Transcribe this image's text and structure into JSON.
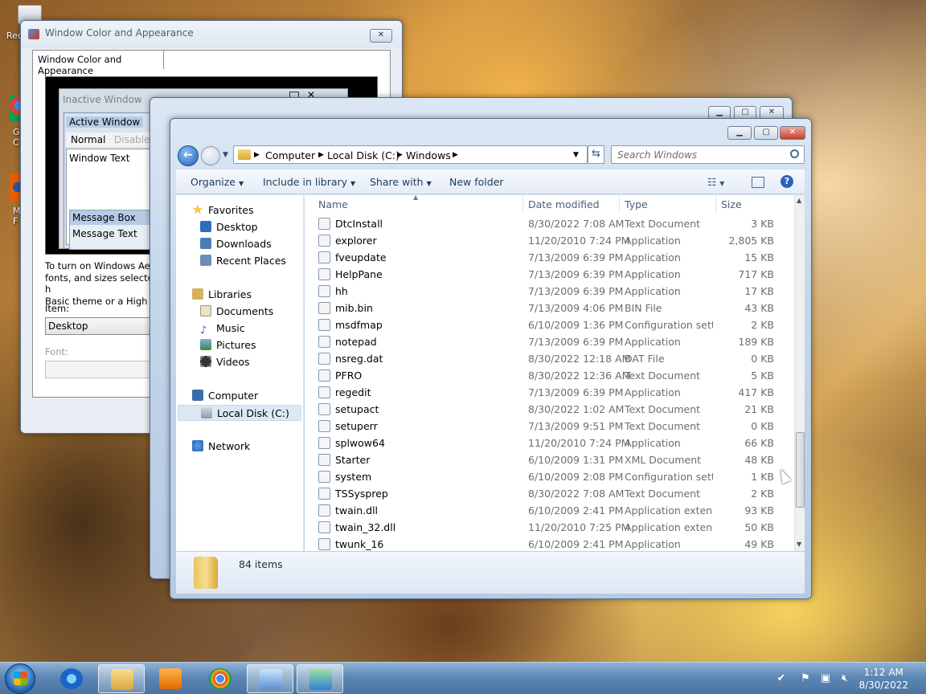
{
  "desktop": {
    "icons": [
      {
        "label": "Rec"
      },
      {
        "label": "G C"
      },
      {
        "label": "M F"
      }
    ]
  },
  "appearance_window": {
    "title": "Window Color and Appearance",
    "tab_label": "Window Color and Appearance",
    "preview": {
      "inactive_window": "Inactive Window",
      "active_window": "Active Window",
      "menu_normal": "Normal",
      "menu_disabled": "Disabled",
      "window_text": "Window Text",
      "message_box": "Message Box",
      "message_text": "Message Text"
    },
    "info_text_1": "To turn on Windows Aero",
    "info_text_2": "fonts, and sizes selected h",
    "info_text_3": "Basic theme or a High Co",
    "item_label": "Item:",
    "item_value": "Desktop",
    "font_label": "Font:"
  },
  "explorer": {
    "breadcrumb": [
      "Computer",
      "Local Disk (C:)",
      "Windows"
    ],
    "search_placeholder": "Search Windows",
    "commands": {
      "organize": "Organize",
      "include_in_library": "Include in library",
      "share_with": "Share with",
      "new_folder": "New folder"
    },
    "nav": {
      "favorites": "Favorites",
      "desktop": "Desktop",
      "downloads": "Downloads",
      "recent_places": "Recent Places",
      "libraries": "Libraries",
      "documents": "Documents",
      "music": "Music",
      "pictures": "Pictures",
      "videos": "Videos",
      "computer": "Computer",
      "local_disk": "Local Disk (C:)",
      "network": "Network"
    },
    "columns": {
      "name": "Name",
      "date": "Date modified",
      "type": "Type",
      "size": "Size"
    },
    "files": [
      {
        "name": "DtcInstall",
        "date": "8/30/2022 7:08 AM",
        "type": "Text Document",
        "size": "3 KB"
      },
      {
        "name": "explorer",
        "date": "11/20/2010 7:24 PM",
        "type": "Application",
        "size": "2,805 KB"
      },
      {
        "name": "fveupdate",
        "date": "7/13/2009 6:39 PM",
        "type": "Application",
        "size": "15 KB"
      },
      {
        "name": "HelpPane",
        "date": "7/13/2009 6:39 PM",
        "type": "Application",
        "size": "717 KB"
      },
      {
        "name": "hh",
        "date": "7/13/2009 6:39 PM",
        "type": "Application",
        "size": "17 KB"
      },
      {
        "name": "mib.bin",
        "date": "7/13/2009 4:06 PM",
        "type": "BIN File",
        "size": "43 KB"
      },
      {
        "name": "msdfmap",
        "date": "6/10/2009 1:36 PM",
        "type": "Configuration sett...",
        "size": "2 KB"
      },
      {
        "name": "notepad",
        "date": "7/13/2009 6:39 PM",
        "type": "Application",
        "size": "189 KB"
      },
      {
        "name": "nsreg.dat",
        "date": "8/30/2022 12:18 AM",
        "type": "DAT File",
        "size": "0 KB"
      },
      {
        "name": "PFRO",
        "date": "8/30/2022 12:36 AM",
        "type": "Text Document",
        "size": "5 KB"
      },
      {
        "name": "regedit",
        "date": "7/13/2009 6:39 PM",
        "type": "Application",
        "size": "417 KB"
      },
      {
        "name": "setupact",
        "date": "8/30/2022 1:02 AM",
        "type": "Text Document",
        "size": "21 KB"
      },
      {
        "name": "setuperr",
        "date": "7/13/2009 9:51 PM",
        "type": "Text Document",
        "size": "0 KB"
      },
      {
        "name": "splwow64",
        "date": "11/20/2010 7:24 PM",
        "type": "Application",
        "size": "66 KB"
      },
      {
        "name": "Starter",
        "date": "6/10/2009 1:31 PM",
        "type": "XML Document",
        "size": "48 KB"
      },
      {
        "name": "system",
        "date": "6/10/2009 2:08 PM",
        "type": "Configuration sett...",
        "size": "1 KB"
      },
      {
        "name": "TSSysprep",
        "date": "8/30/2022 7:08 AM",
        "type": "Text Document",
        "size": "2 KB"
      },
      {
        "name": "twain.dll",
        "date": "6/10/2009 2:41 PM",
        "type": "Application extens...",
        "size": "93 KB"
      },
      {
        "name": "twain_32.dll",
        "date": "11/20/2010 7:25 PM",
        "type": "Application extens...",
        "size": "50 KB"
      },
      {
        "name": "twunk_16",
        "date": "6/10/2009 2:41 PM",
        "type": "Application",
        "size": "49 KB"
      }
    ],
    "status": "84 items"
  },
  "taskbar": {
    "clock_time": "1:12 AM",
    "clock_date": "8/30/2022"
  },
  "colors": {
    "taskbar": "#5d87b4",
    "link_blue": "#1e395b",
    "selection": "#dde8f5"
  }
}
